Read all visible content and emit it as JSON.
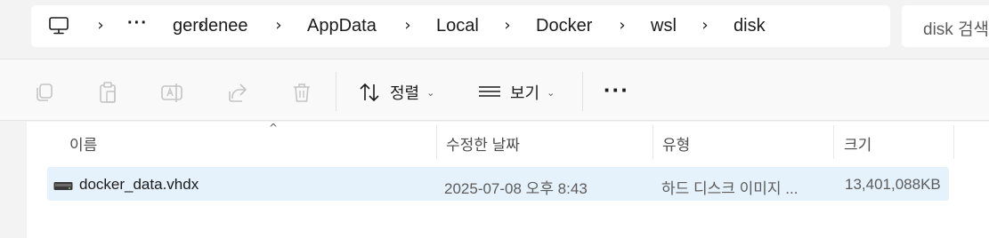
{
  "address_bar": {
    "overflow": "···",
    "breadcrumbs": [
      "gerdenee",
      "AppData",
      "Local",
      "Docker",
      "wsl",
      "disk"
    ]
  },
  "search": {
    "placeholder": "disk 검색"
  },
  "command_bar": {
    "sort_label": "정렬",
    "view_label": "보기",
    "more": "···"
  },
  "columns": [
    "이름",
    "수정한 날짜",
    "유형",
    "크기"
  ],
  "files": [
    {
      "name": "docker_data.vhdx",
      "modified": "2025-07-08 오후 8:43",
      "type": "하드 디스크 이미지 ...",
      "size": "13,401,088KB"
    }
  ],
  "colors": {
    "selection": "#e5f1fb",
    "window": "#f3f3f3"
  }
}
